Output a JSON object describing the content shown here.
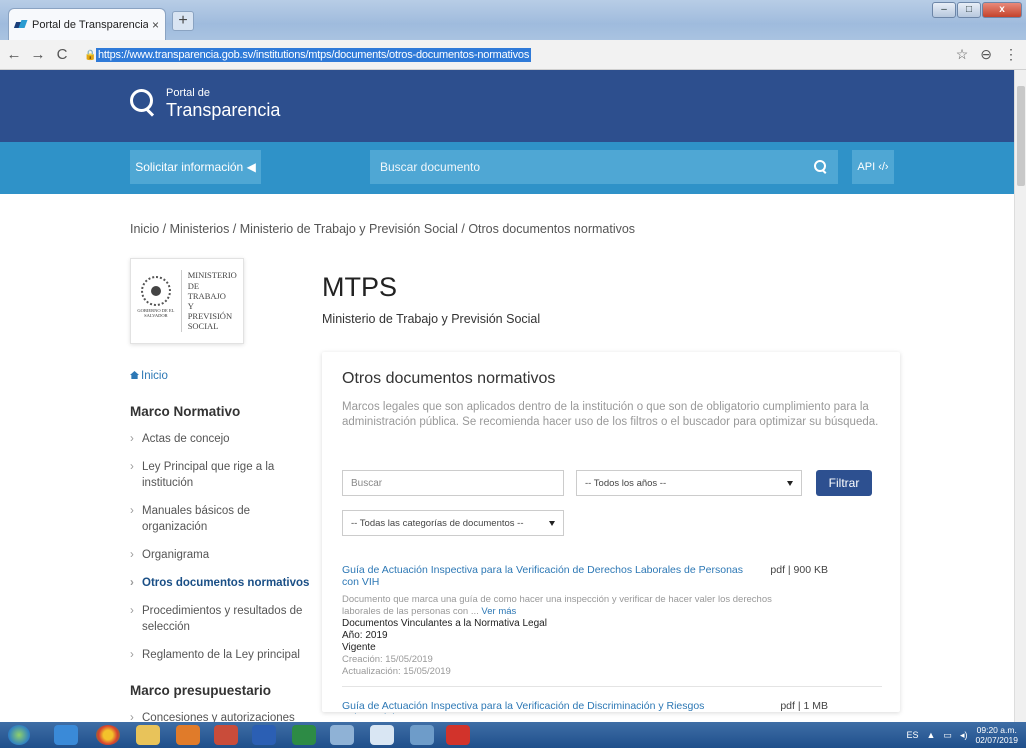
{
  "browser": {
    "tab_title": "Portal de Transparencia - El Salv",
    "tab_close": "×",
    "new_tab": "+",
    "url": "https://www.transparencia.gob.sv/institutions/mtps/documents/otros-documentos-normativos",
    "back": "←",
    "forward": "→",
    "reload": "C",
    "star": "☆",
    "account": "⊖",
    "menu": "⋮",
    "minimize": "–",
    "maximize": "□",
    "close": "x"
  },
  "site": {
    "logo_small": "Portal de",
    "logo_big": "Transparencia",
    "solicitar": "Solicitar información ◀",
    "search_placeholder": "Buscar documento",
    "api": "API ‹/›"
  },
  "breadcrumb": "Inicio / Ministerios / Ministerio de Trabajo y Previsión Social / Otros documentos normativos",
  "ministry": {
    "seal_text": "GOBIERNO DE EL SALVADOR",
    "name_lines": [
      "MINISTERIO",
      "DE TRABAJO",
      "Y PREVISIÓN",
      "SOCIAL"
    ],
    "acronym": "MTPS",
    "full_name": "Ministerio de Trabajo y Previsión Social"
  },
  "sidebar": {
    "home": "Inicio",
    "heading1": "Marco Normativo",
    "items": [
      "Actas de concejo",
      "Ley Principal que rige a la institución",
      "Manuales básicos de organización",
      "Organigrama",
      "Otros documentos normativos",
      "Procedimientos y resultados de selección",
      "Reglamento de la Ley principal"
    ],
    "heading2": "Marco presupuestario",
    "items2": [
      "Concesiones y autorizaciones"
    ]
  },
  "main": {
    "title": "Otros documentos normativos",
    "description": "Marcos legales que son aplicados dentro de la institución o que son de obligatorio cumplimiento para la administración pública. Se recomienda hacer uso de los filtros o el buscador para optimizar su búsqueda.",
    "search_placeholder": "Buscar",
    "year_select": "-- Todos los años --",
    "category_select": "-- Todas las categorías de documentos --",
    "filter_button": "Filtrar",
    "documents": [
      {
        "title": "Guía de Actuación Inspectiva para la Verificación de Derechos Laborales de Personas con VIH",
        "meta": "pdf | 900 KB",
        "description": "Documento que marca una guía de como hacer una inspección y verificar de hacer valer los derechos laborales de las personas con ...",
        "more": "Ver más",
        "category": "Documentos Vinculantes a la Normativa Legal",
        "year": "Año: 2019",
        "status": "Vigente",
        "created": "Creación: 15/05/2019",
        "updated": "Actualización: 15/05/2019"
      },
      {
        "title": "Guía de Actuación Inspectiva para la Verificación de Discriminación y Riesgos Psicosociales",
        "meta": "pdf | 1 MB"
      }
    ]
  },
  "taskbar": {
    "lang": "ES",
    "time": "09:20 a.m.",
    "date": "02/07/2019"
  }
}
